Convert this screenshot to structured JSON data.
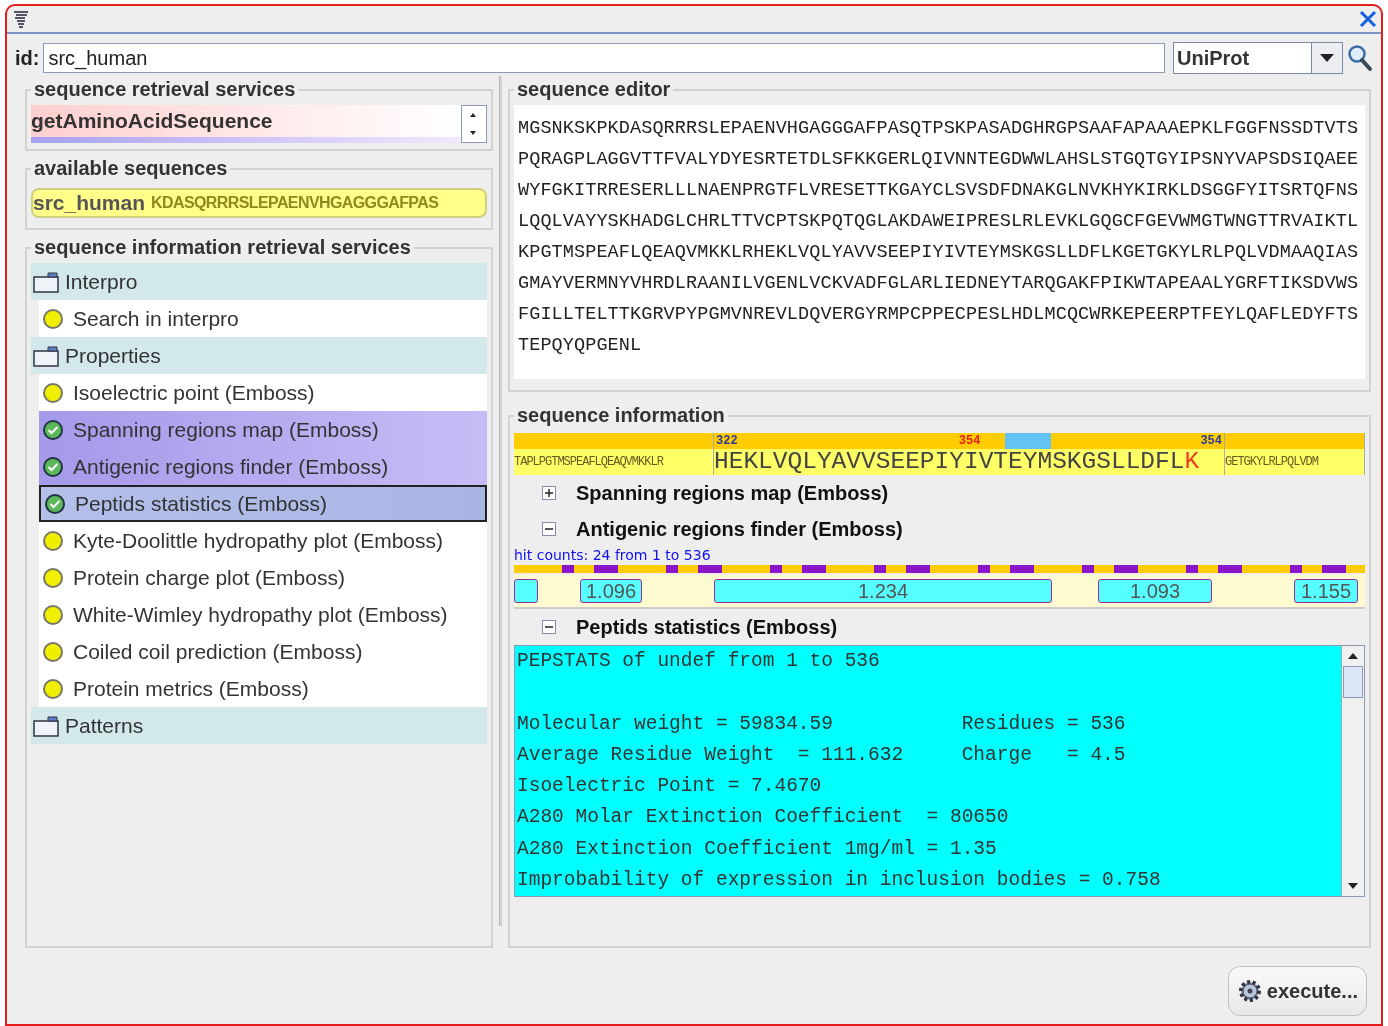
{
  "id_field": {
    "label": "id:",
    "value": "src_human"
  },
  "database_select": {
    "value": "UniProt"
  },
  "retrieval_services": {
    "title": "sequence retrieval services",
    "items": [
      {
        "label": "getAminoAcidSequence",
        "selected": true
      }
    ]
  },
  "available_sequences": {
    "title": "available sequences",
    "items": [
      {
        "label": "src_human",
        "preview": "KDASQRRRSLEPAENVHGAGGGAFPAS",
        "selected": true
      }
    ]
  },
  "info_services": {
    "title": "sequence information retrieval services",
    "groups": [
      {
        "label": "Interpro",
        "children": [
          {
            "label": "Search in interpro",
            "done": false,
            "selected": false,
            "focused": false
          }
        ]
      },
      {
        "label": "Properties",
        "children": [
          {
            "label": "Isoelectric point (Emboss)",
            "done": false,
            "selected": false,
            "focused": false
          },
          {
            "label": "Spanning regions map (Emboss)",
            "done": true,
            "selected": true,
            "focused": false
          },
          {
            "label": "Antigenic regions finder (Emboss)",
            "done": true,
            "selected": true,
            "focused": false
          },
          {
            "label": "Peptids statistics (Emboss)",
            "done": true,
            "selected": true,
            "focused": true
          },
          {
            "label": "Kyte-Doolittle hydropathy plot (Emboss)",
            "done": false,
            "selected": false,
            "focused": false
          },
          {
            "label": "Protein charge plot (Emboss)",
            "done": false,
            "selected": false,
            "focused": false
          },
          {
            "label": "White-Wimley hydropathy plot (Emboss)",
            "done": false,
            "selected": false,
            "focused": false
          },
          {
            "label": "Coiled coil prediction (Emboss)",
            "done": false,
            "selected": false,
            "focused": false
          },
          {
            "label": "Protein metrics (Emboss)",
            "done": false,
            "selected": false,
            "focused": false
          }
        ]
      },
      {
        "label": "Patterns"
      }
    ]
  },
  "sequence_editor": {
    "title": "sequence editor",
    "lines": [
      "MGSNKSKPKDASQRRRSLEPAENVHGAGGGAFPASQTPSKPASADGHRGPSAAFAPAAAEPKLFGGFNSSDTVTS",
      "PQRAGPLAGGVTTFVALYDYESRTETDLSFKKGERLQIVNNTEGDWWLAHSLSTGQTGYIPSNYVAPSDSIQAEE",
      "WYFGKITRRESERLLLNAENPRGTFLVRESETTKGAYCLSVSDFDNAKGLNVKHYKIRKLDSGGFYITSRTQFNS",
      "LQQLVAYYSKHADGLCHRLTTVCPTSKPQTQGLAKDAWEIPRESLRLEVKLGQGCFGEVWMGTWNGTTRVAIKTL",
      "KPGTMSPEAFLQEAQVMKKLRHEKLVQLYAVVSEEPIYIVTEYMSKGSLLDFLKGETGKYLRLPQLVDMAAQIAS",
      "GMAYVERMNYVHRDLRAANILVGENLVCKVADFGLARLIEDNEYTARQGAKFPIKWTAPEAALYGRFTIKSDVWS",
      "FGILLTELTTKGRVPYPGMVNREVLDQVERGYRMPCPPECPESLHDLMCQCWRKEPEERPTFEYLQAFLEDYFTS",
      "TEPQYQPGENL"
    ]
  },
  "sequence_information": {
    "title": "sequence information",
    "ruler": {
      "start": "322",
      "mark": "354",
      "end": "354"
    },
    "sequence": {
      "before": "TAPLPGTMSPEAFLQEAQVMKKLR",
      "window": "HEKLVQLYAVVSEEPIYIVTEYMSKGSLLDFL",
      "highlight": "K",
      "after": "GETGKYLRLPQLVDM"
    },
    "sections": [
      {
        "kind": "plain",
        "label": "Spanning regions map (Emboss)",
        "expanded": false
      },
      {
        "kind": "antigenic",
        "label": "Antigenic regions finder (Emboss)",
        "expanded": true,
        "hit_counts": "hit counts: 24 from 1 to 536",
        "values": [
          "1.096",
          "1.234",
          "1.093",
          "1.155"
        ]
      },
      {
        "kind": "report",
        "label": "Peptids statistics (Emboss)",
        "expanded": true,
        "report": "PEPSTATS of undef from 1 to 536\n\nMolecular weight = 59834.59           Residues = 536\nAverage Residue Weight  = 111.632     Charge   = 4.5\nIsoelectric Point = 7.4670\nA280 Molar Extinction Coefficient  = 80650\nA280 Extinction Coefficient 1mg/ml = 1.35\nImprobability of expression in inclusion bodies = 0.758"
      }
    ]
  },
  "execute_button": {
    "label": "execute..."
  }
}
